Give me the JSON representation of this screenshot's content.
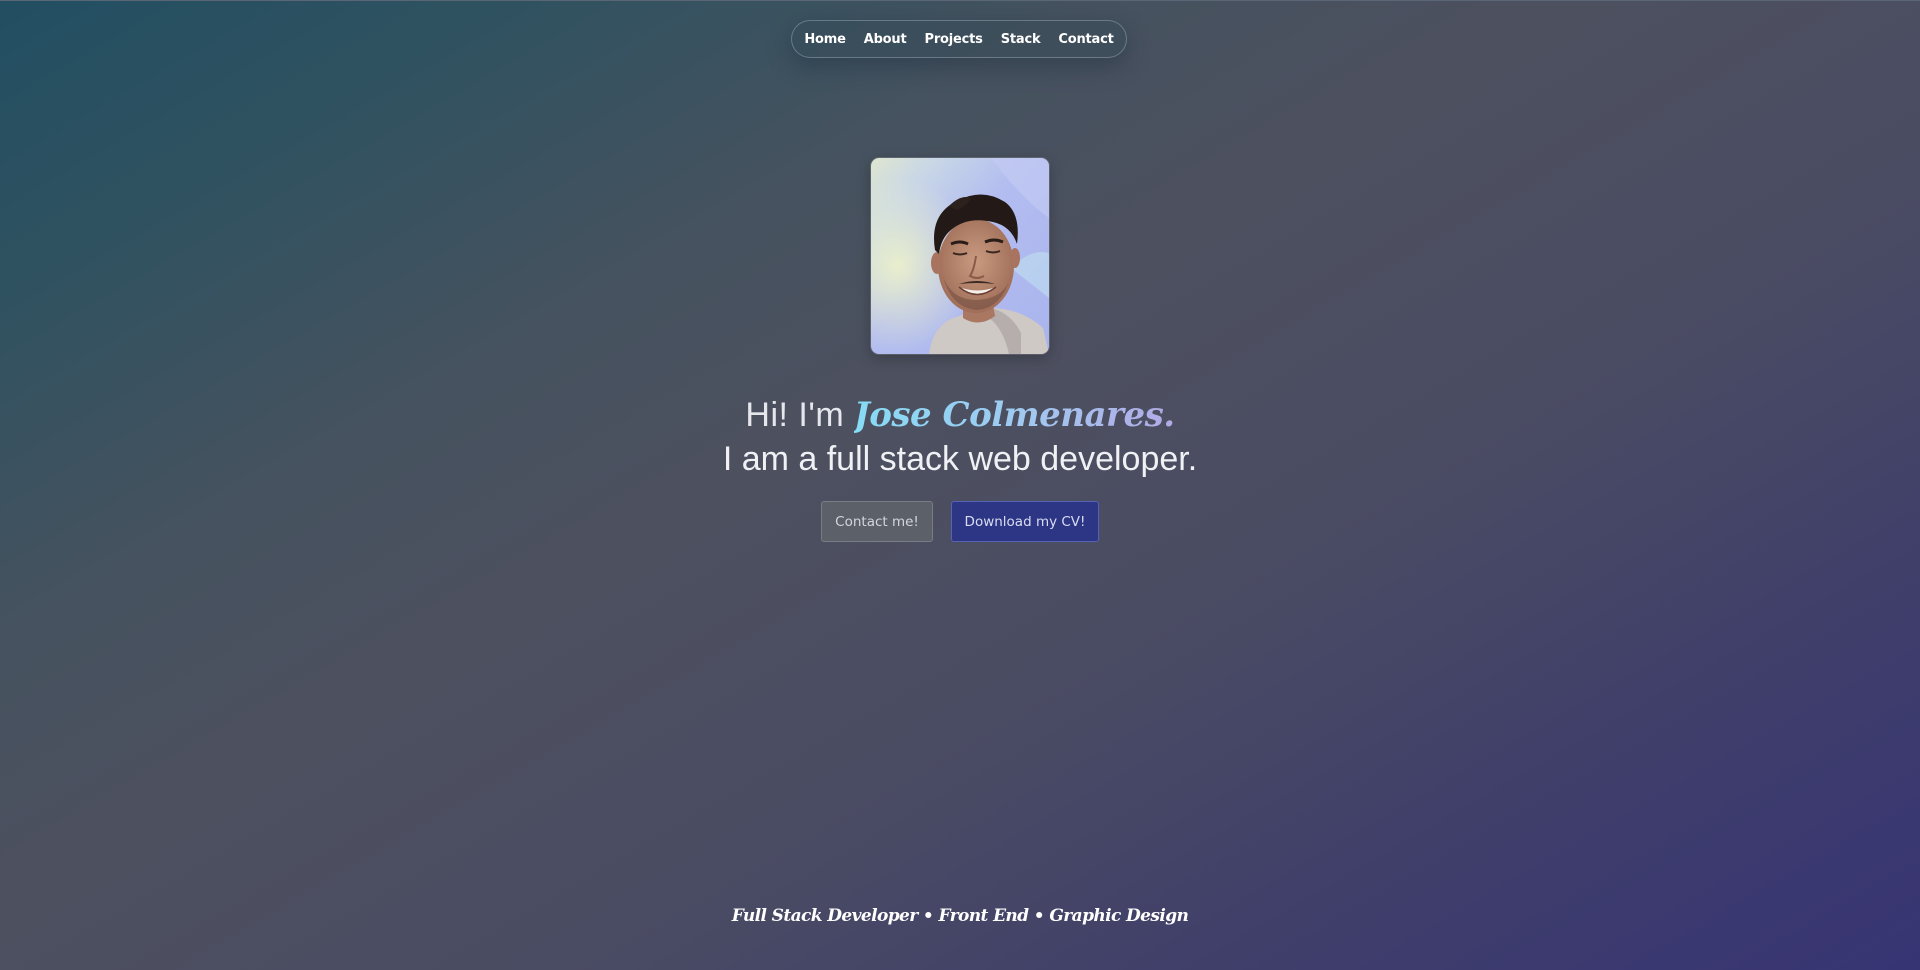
{
  "nav": {
    "items": [
      {
        "label": "Home"
      },
      {
        "label": "About"
      },
      {
        "label": "Projects"
      },
      {
        "label": "Stack"
      },
      {
        "label": "Contact"
      }
    ]
  },
  "hero": {
    "avatar_icon": "profile-photo",
    "greeting_prefix": "Hi! I'm",
    "name": "Jose Colmenares.",
    "tagline": "I am a full stack web developer."
  },
  "buttons": {
    "contact_label": "Contact me!",
    "cv_label": "Download my CV!"
  },
  "footer": {
    "roles": "Full Stack Developer • Front End • Graphic Design"
  },
  "colors": {
    "background_start": "#224e62",
    "background_end": "#373474",
    "name_gradient_start": "#86dcf5",
    "name_gradient_end": "#b2a9e6",
    "cv_button": "#2d3684",
    "contact_button": "#5c6069"
  }
}
